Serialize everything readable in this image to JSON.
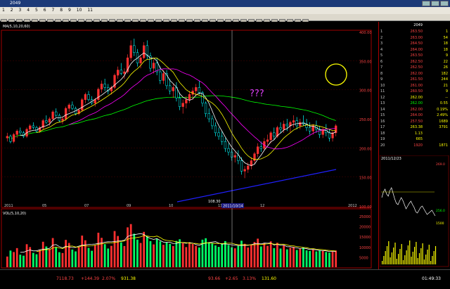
{
  "chart_data": {
    "type": "candlestick",
    "candles": [
      [
        149,
        152,
        147,
        150
      ],
      [
        150,
        151,
        146,
        147
      ],
      [
        147,
        152,
        146,
        151
      ],
      [
        151,
        154,
        149,
        153
      ],
      [
        153,
        155,
        151,
        152
      ],
      [
        152,
        153,
        149,
        150
      ],
      [
        150,
        155,
        149,
        154
      ],
      [
        154,
        157,
        152,
        156
      ],
      [
        156,
        158,
        154,
        155
      ],
      [
        155,
        156,
        152,
        153
      ],
      [
        153,
        156,
        152,
        155
      ],
      [
        155,
        160,
        154,
        159
      ],
      [
        159,
        162,
        157,
        158
      ],
      [
        158,
        161,
        156,
        160
      ],
      [
        160,
        165,
        159,
        164
      ],
      [
        164,
        166,
        161,
        162
      ],
      [
        162,
        163,
        158,
        159
      ],
      [
        159,
        161,
        157,
        160
      ],
      [
        160,
        167,
        159,
        166
      ],
      [
        166,
        169,
        164,
        168
      ],
      [
        168,
        170,
        165,
        166
      ],
      [
        166,
        167,
        162,
        163
      ],
      [
        163,
        166,
        162,
        165
      ],
      [
        165,
        172,
        164,
        171
      ],
      [
        171,
        175,
        169,
        174
      ],
      [
        174,
        176,
        170,
        171
      ],
      [
        171,
        173,
        168,
        169
      ],
      [
        169,
        172,
        167,
        171
      ],
      [
        171,
        178,
        170,
        177
      ],
      [
        177,
        182,
        175,
        180
      ],
      [
        180,
        183,
        176,
        178
      ],
      [
        178,
        180,
        174,
        176
      ],
      [
        176,
        179,
        174,
        178
      ],
      [
        178,
        186,
        177,
        185
      ],
      [
        185,
        190,
        183,
        188
      ],
      [
        188,
        192,
        185,
        186
      ],
      [
        186,
        189,
        183,
        187
      ],
      [
        187,
        197,
        186,
        195
      ],
      [
        195,
        205,
        193,
        202
      ],
      [
        202,
        206,
        196,
        198
      ],
      [
        198,
        200,
        190,
        192
      ],
      [
        192,
        196,
        189,
        195
      ],
      [
        195,
        204,
        194,
        202
      ],
      [
        202,
        205,
        194,
        196
      ],
      [
        196,
        198,
        187,
        189
      ],
      [
        189,
        194,
        186,
        192
      ],
      [
        192,
        195,
        185,
        187
      ],
      [
        187,
        190,
        180,
        182
      ],
      [
        182,
        188,
        180,
        186
      ],
      [
        186,
        188,
        177,
        179
      ],
      [
        179,
        183,
        174,
        176
      ],
      [
        176,
        180,
        172,
        178
      ],
      [
        178,
        181,
        170,
        172
      ],
      [
        172,
        175,
        165,
        167
      ],
      [
        167,
        171,
        163,
        169
      ],
      [
        169,
        173,
        166,
        171
      ],
      [
        171,
        176,
        169,
        174
      ],
      [
        174,
        178,
        171,
        176
      ],
      [
        176,
        180,
        173,
        178
      ],
      [
        178,
        182,
        174,
        175
      ],
      [
        175,
        176,
        167,
        169
      ],
      [
        169,
        170,
        161,
        163
      ],
      [
        163,
        166,
        158,
        160
      ],
      [
        160,
        162,
        154,
        156
      ],
      [
        156,
        158,
        150,
        152
      ],
      [
        152,
        155,
        148,
        150
      ],
      [
        150,
        153,
        145,
        147
      ],
      [
        147,
        149,
        141,
        143
      ],
      [
        143,
        146,
        139,
        141
      ],
      [
        141,
        143,
        136,
        138
      ],
      [
        138,
        141,
        135,
        139
      ],
      [
        139,
        142,
        134,
        136
      ],
      [
        136,
        138,
        128,
        130
      ],
      [
        130,
        133,
        126,
        131
      ],
      [
        131,
        135,
        129,
        133
      ],
      [
        133,
        138,
        131,
        136
      ],
      [
        136,
        141,
        134,
        140
      ],
      [
        140,
        146,
        138,
        144
      ],
      [
        144,
        147,
        141,
        143
      ],
      [
        143,
        149,
        142,
        147
      ],
      [
        147,
        151,
        145,
        148
      ],
      [
        148,
        153,
        146,
        152
      ],
      [
        152,
        155,
        148,
        150
      ],
      [
        150,
        156,
        149,
        155
      ],
      [
        155,
        158,
        152,
        154
      ],
      [
        154,
        159,
        152,
        157
      ],
      [
        157,
        160,
        153,
        156
      ],
      [
        156,
        159,
        152,
        158
      ],
      [
        158,
        162,
        155,
        159
      ],
      [
        159,
        161,
        154,
        156
      ],
      [
        156,
        160,
        154,
        158
      ],
      [
        158,
        162,
        156,
        157
      ],
      [
        157,
        160,
        153,
        155
      ],
      [
        155,
        158,
        151,
        153
      ],
      [
        153,
        157,
        151,
        156
      ],
      [
        156,
        159,
        152,
        154
      ],
      [
        154,
        156,
        149,
        151
      ],
      [
        151,
        155,
        149,
        154
      ],
      [
        154,
        157,
        150,
        152
      ],
      [
        152,
        154,
        147,
        149
      ],
      [
        149,
        153,
        147,
        152
      ],
      [
        152,
        157,
        150,
        156
      ]
    ],
    "volume": [
      5200,
      8100,
      7400,
      9300,
      6100,
      5600,
      11200,
      9800,
      7000,
      6300,
      8400,
      12400,
      10100,
      8800,
      14200,
      9700,
      7300,
      6900,
      13300,
      11800,
      8600,
      7700,
      9900,
      15400,
      13100,
      9400,
      8000,
      10600,
      16800,
      14300,
      11200,
      9100,
      10400,
      17600,
      15200,
      12100,
      10300,
      19400,
      21000,
      16300,
      13400,
      11800,
      17200,
      14900,
      12700,
      11100,
      13800,
      12600,
      10900,
      12200,
      11400,
      10300,
      12800,
      13600,
      11700,
      9800,
      12100,
      11300,
      10400,
      9600,
      13400,
      14100,
      12200,
      11800,
      10600,
      9900,
      11600,
      12700,
      10800,
      9700,
      9200,
      10300,
      12900,
      11400,
      9600,
      10800,
      12300,
      13900,
      10100,
      11700,
      10400,
      12600,
      9300,
      11900,
      9100,
      10800,
      8700,
      9500,
      9900,
      8400,
      8900,
      9700,
      8200,
      7900,
      8600,
      7700,
      8300,
      7900,
      7400,
      7100,
      7600,
      8100
    ],
    "price_ylim": [
      110,
      210
    ],
    "volume_ylim": [
      0,
      25000
    ],
    "price_ticks": [
      "400.00",
      "350.00",
      "300.00",
      "250.00",
      "200.00",
      "150.00",
      "100.00"
    ],
    "volume_ticks": [
      "25000",
      "20000",
      "15000",
      "10000",
      "5000"
    ],
    "x_ticks": [
      "2011",
      "05",
      "07",
      "09",
      "10",
      "11",
      "12",
      "2012"
    ],
    "ma_header": "MA(5,10,20,60)",
    "vol_header": "VOL(5,10,20)",
    "low_marker": "108.30",
    "crosshair_label": "2011/10/14"
  },
  "colors": {
    "up": "#ff3030",
    "down": "#00ffff",
    "ma5": "#ffffff",
    "ma10": "#ffff00",
    "ma20": "#ff00ff",
    "ma60": "#00ff00",
    "trend": "#2020ff",
    "annotation": "#e040fb",
    "circle": "#ffff00"
  },
  "window": {
    "title": "2049"
  },
  "menu": [
    "1",
    "2",
    "3",
    "4",
    "5",
    "6",
    "7",
    "8",
    "9",
    "10",
    "11"
  ],
  "annotation": {
    "text": "???"
  },
  "quote": {
    "code": "2049",
    "rows": [
      {
        "lbl": "1",
        "v1": "263.50",
        "v2": "1"
      },
      {
        "lbl": "2",
        "v1": "263.00",
        "v2": "54"
      },
      {
        "lbl": "3",
        "v1": "264.50",
        "v2": "18"
      },
      {
        "lbl": "4",
        "v1": "264.00",
        "v2": "18"
      },
      {
        "lbl": "5",
        "v1": "263.50",
        "v2": "9"
      },
      {
        "lbl": "6",
        "v1": "262.50",
        "v2": "22"
      },
      {
        "lbl": "7",
        "v1": "262.50",
        "v2": "26"
      },
      {
        "lbl": "8",
        "v1": "262.00",
        "v2": "182"
      },
      {
        "lbl": "9",
        "v1": "261.50",
        "v2": "244"
      },
      {
        "lbl": "10",
        "v1": "261.00",
        "v2": "21"
      },
      {
        "lbl": "11",
        "v1": "260.50",
        "v2": "9"
      },
      {
        "lbl": "12",
        "v1": "262.00",
        "v2": "--"
      },
      {
        "lbl": "13",
        "v1": "262.00",
        "v2": "0.55"
      },
      {
        "lbl": "14",
        "v1": "262.00",
        "v2": "0.19%"
      },
      {
        "lbl": "15",
        "v1": "264.00",
        "v2": "2.49%"
      },
      {
        "lbl": "16",
        "v1": "257.50",
        "v2": "1689"
      },
      {
        "lbl": "17",
        "v1": "263.38",
        "v2": "3791"
      },
      {
        "lbl": "18",
        "v1": "1.13",
        "v2": ""
      },
      {
        "lbl": "19",
        "v1": "665",
        "v2": ""
      },
      {
        "lbl": "20",
        "v1": "1920",
        "v2": "1871"
      }
    ]
  },
  "mini": {
    "date": "2011/12/23",
    "hi": "269.0",
    "lo": "256.0",
    "vol_max": "1500"
  },
  "status": {
    "item1": "7118.73",
    "item2": "+144.39",
    "item3": "2.07%",
    "item4": "931.38",
    "item5": "93.66",
    "item6": "+2.65",
    "item7": "3.13%",
    "item8": "131.60",
    "clock": "01:49:33"
  }
}
